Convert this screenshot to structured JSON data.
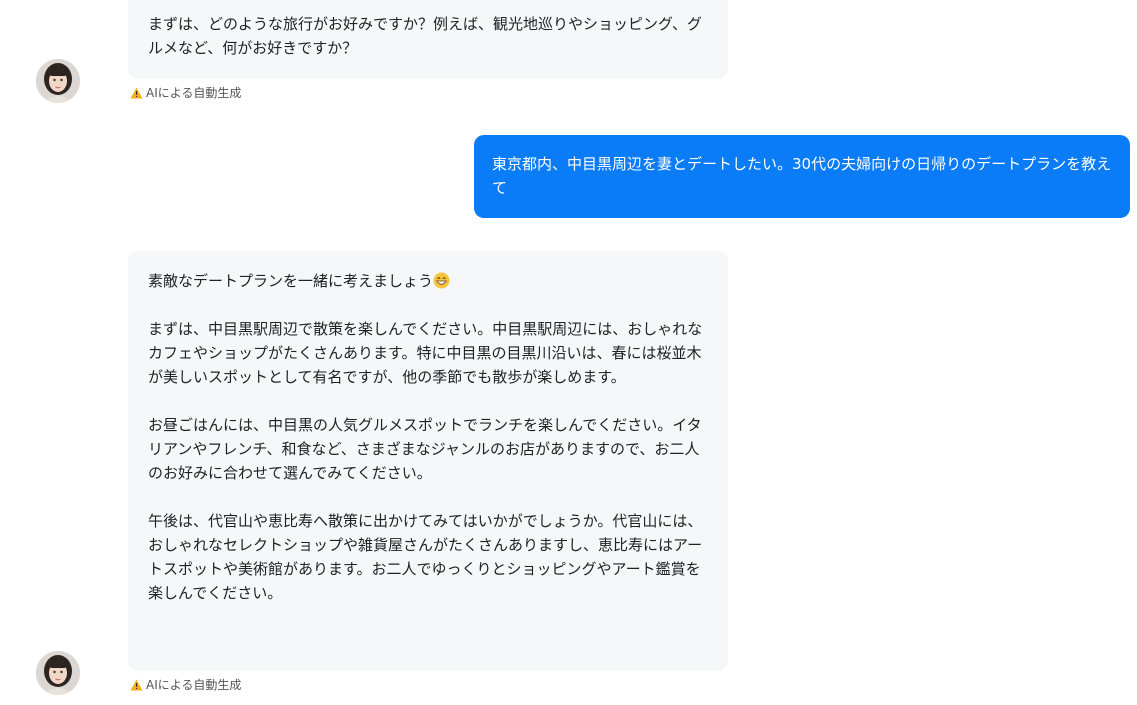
{
  "messages": {
    "ai_1": {
      "paragraphs": [
        "まずは、どのような旅行がお好みですか？例えば、観光地巡りやショッピング、グルメなど、何がお好きですか？"
      ],
      "notice": "AIによる自動生成"
    },
    "user_1": {
      "text": "東京都内、中目黒周辺を妻とデートしたい。30代の夫婦向けの日帰りのデートプランを教えて"
    },
    "ai_2": {
      "intro": "素敵なデートプランを一緒に考えましょう",
      "emoji": "smiling-face-icon",
      "paragraphs": [
        "まずは、中目黒駅周辺で散策を楽しんでください。中目黒駅周辺には、おしゃれなカフェやショップがたくさんあります。特に中目黒の目黒川沿いは、春には桜並木が美しいスポットとして有名ですが、他の季節でも散歩が楽しめます。",
        "お昼ごはんには、中目黒の人気グルメスポットでランチを楽しんでください。イタリアンやフレンチ、和食など、さまざまなジャンルのお店がありますので、お二人のお好みに合わせて選んでみてください。",
        "午後は、代官山や恵比寿へ散策に出かけてみてはいかがでしょうか。代官山には、おしゃれなセレクトショップや雑貨屋さんがたくさんありますし、恵比寿にはアートスポットや美術館があります。お二人でゆっくりとショッピングやアート鑑賞を楽しんでください。"
      ],
      "notice": "AIによる自動生成"
    }
  },
  "icons": {
    "warning": "warning-icon",
    "avatar": "avatar"
  },
  "colors": {
    "user_bubble": "#0a7cf7",
    "ai_bubble": "#f6f7f9",
    "warning": "#f2b21c"
  }
}
